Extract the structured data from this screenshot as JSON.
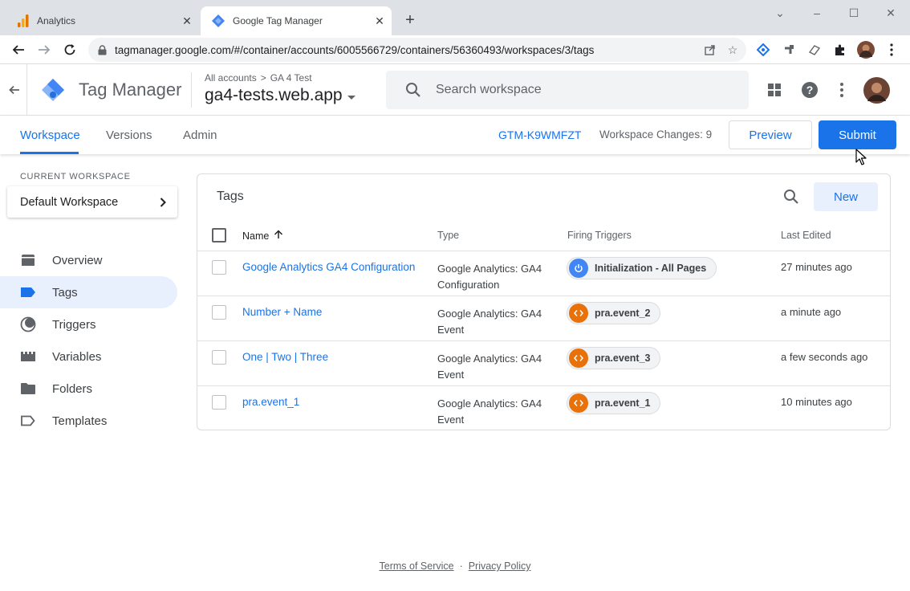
{
  "browser": {
    "tabs": [
      {
        "title": "Analytics",
        "icon": "analytics-icon",
        "active": false
      },
      {
        "title": "Google Tag Manager",
        "icon": "gtm-icon",
        "active": true
      }
    ],
    "url": "tagmanager.google.com/#/container/accounts/6005566729/containers/56360493/workspaces/3/tags"
  },
  "header": {
    "app_title": "Tag Manager",
    "breadcrumb": {
      "accounts": "All accounts",
      "separator": ">",
      "account": "GA 4 Test"
    },
    "container_name": "ga4-tests.web.app",
    "search_placeholder": "Search workspace"
  },
  "nav": {
    "tabs": [
      {
        "label": "Workspace",
        "active": true
      },
      {
        "label": "Versions",
        "active": false
      },
      {
        "label": "Admin",
        "active": false
      }
    ],
    "container_id": "GTM-K9WMFZT",
    "workspace_changes": "Workspace Changes: 9",
    "preview_label": "Preview",
    "submit_label": "Submit"
  },
  "sidebar": {
    "current_workspace_label": "CURRENT WORKSPACE",
    "workspace_name": "Default Workspace",
    "items": [
      {
        "label": "Overview",
        "icon": "overview-icon",
        "active": false
      },
      {
        "label": "Tags",
        "icon": "tag-icon",
        "active": true
      },
      {
        "label": "Triggers",
        "icon": "trigger-icon",
        "active": false
      },
      {
        "label": "Variables",
        "icon": "variables-icon",
        "active": false
      },
      {
        "label": "Folders",
        "icon": "folder-icon",
        "active": false
      },
      {
        "label": "Templates",
        "icon": "template-icon",
        "active": false
      }
    ]
  },
  "tags_card": {
    "title": "Tags",
    "new_label": "New",
    "columns": {
      "name": "Name",
      "type": "Type",
      "triggers": "Firing Triggers",
      "edited": "Last Edited"
    },
    "rows": [
      {
        "name": "Google Analytics GA4 Configuration",
        "type": "Google Analytics: GA4 Configuration",
        "trigger": "Initialization - All Pages",
        "trigger_icon": "power-icon",
        "trigger_color": "#4285f4",
        "edited": "27 minutes ago"
      },
      {
        "name": "Number + Name",
        "type": "Google Analytics: GA4 Event",
        "trigger": "pra.event_2",
        "trigger_icon": "code-icon",
        "trigger_color": "#e8710a",
        "edited": "a minute ago"
      },
      {
        "name": "One | Two | Three",
        "type": "Google Analytics: GA4 Event",
        "trigger": "pra.event_3",
        "trigger_icon": "code-icon",
        "trigger_color": "#e8710a",
        "edited": "a few seconds ago"
      },
      {
        "name": "pra.event_1",
        "type": "Google Analytics: GA4 Event",
        "trigger": "pra.event_1",
        "trigger_icon": "code-icon",
        "trigger_color": "#e8710a",
        "edited": "10 minutes ago"
      }
    ]
  },
  "footer": {
    "terms": "Terms of Service",
    "separator": "·",
    "privacy": "Privacy Policy"
  },
  "colors": {
    "accent": "#1a73e8",
    "active_nav_bg": "#e8f0fe",
    "custom_event": "#e8710a",
    "init_trigger": "#4285f4"
  }
}
